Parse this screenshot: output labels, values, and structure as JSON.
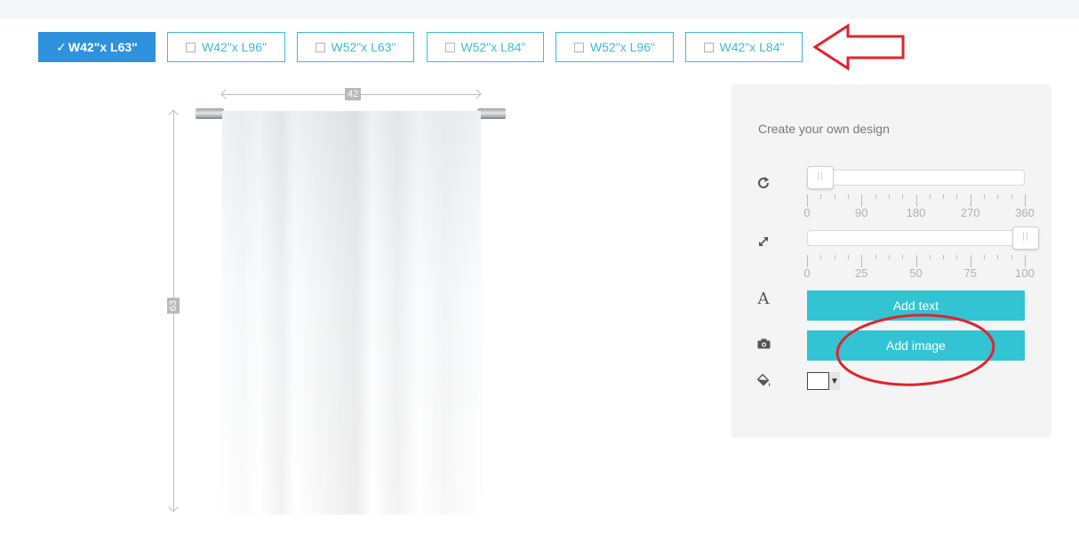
{
  "size_options": [
    {
      "label": "W42\"x L63\"",
      "selected": true
    },
    {
      "label": "W42\"x L96\"",
      "selected": false
    },
    {
      "label": "W52\"x L63\"",
      "selected": false
    },
    {
      "label": "W52\"x L84\"",
      "selected": false
    },
    {
      "label": "W52\"x L96\"",
      "selected": false
    },
    {
      "label": "W42\"x L84\"",
      "selected": false
    }
  ],
  "preview": {
    "width_label": "42",
    "height_label": "63"
  },
  "design_panel": {
    "title": "Create your own design",
    "rotate": {
      "icon": "rotate-icon",
      "value": 0,
      "min": 0,
      "max": 360,
      "tick_labels": [
        "0",
        "90",
        "180",
        "270",
        "360"
      ]
    },
    "scale": {
      "icon": "resize-icon",
      "value": 100,
      "min": 0,
      "max": 100,
      "tick_labels": [
        "0",
        "25",
        "50",
        "75",
        "100"
      ]
    },
    "add_text": {
      "icon": "text-icon",
      "label": "Add text"
    },
    "add_image": {
      "icon": "camera-icon",
      "label": "Add image"
    },
    "fill": {
      "icon": "paint-bucket-icon",
      "color": "#ffffff",
      "caret": "▼"
    }
  },
  "colors": {
    "accent": "#32c4d3",
    "selected_tab": "#2e92dd",
    "annotation": "#e0242c"
  }
}
